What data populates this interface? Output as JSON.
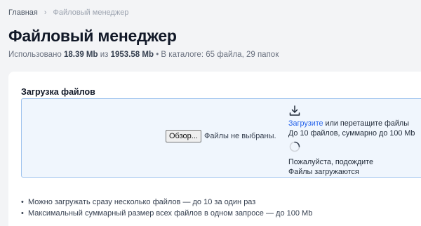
{
  "breadcrumb": {
    "home": "Главная",
    "separator": "›",
    "current": "Файловый менеджер"
  },
  "page": {
    "title": "Файловый менеджер"
  },
  "usage": {
    "prefix": "Использовано ",
    "used": "18.39 Mb",
    "middle": " из ",
    "total": "1953.58 Mb",
    "catalog": " • В каталоге: 65 файла, 29 папок"
  },
  "upload": {
    "title": "Загрузка файлов",
    "browse_label": "Обзор...",
    "no_files": "Файлы не выбраны.",
    "upload_link": "Загрузите",
    "drag_text": " или перетащите файлы",
    "limit_text": "До 10 файлов, суммарно до 100 Mb",
    "wait_text": "Пожалуйста, подождите",
    "uploading_text": "Файлы загружаются"
  },
  "rules": [
    "Можно загружать сразу несколько файлов — до 10 за один раз",
    "Максимальный суммарный размер всех файлов в одном запросе — до 100 Mb"
  ],
  "colors": {
    "accent": "#2563eb",
    "dropzone_bg": "#f0f6fd",
    "dropzone_border": "#9fc3ee"
  },
  "icons": {
    "upload": "download-arrow-icon",
    "spinner": "loading-spinner-icon",
    "breadcrumb_separator": "chevron-right-icon"
  }
}
